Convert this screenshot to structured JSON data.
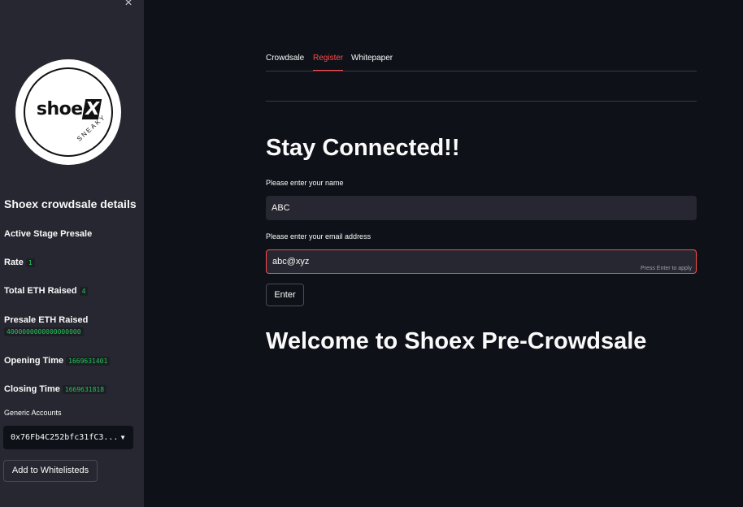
{
  "sidebar": {
    "close_glyph": "×",
    "logo": {
      "word": "shoe",
      "x_mark": "X",
      "tagline": "SNEAKY"
    },
    "title": "Shoex crowdsale details",
    "active_stage": "Active Stage Presale",
    "rate": {
      "label": "Rate",
      "value": "1"
    },
    "total_eth": {
      "label": "Total ETH Raised",
      "value": "4"
    },
    "presale_eth": {
      "label": "Presale ETH Raised",
      "value": "4000000000000000000"
    },
    "opening_time": {
      "label": "Opening Time",
      "value": "1669631401"
    },
    "closing_time": {
      "label": "Closing Time",
      "value": "1669631818"
    },
    "accounts_label": "Generic Accounts",
    "account_selected": "0x76Fb4C252bfc31fC3...",
    "whitelist_button": "Add to Whitelisteds"
  },
  "tabs": [
    {
      "label": "Crowdsale",
      "active": false
    },
    {
      "label": "Register",
      "active": true
    },
    {
      "label": "Whitepaper",
      "active": false
    }
  ],
  "main": {
    "heading": "Stay Connected!!",
    "name_label": "Please enter your name",
    "name_value": "ABC",
    "email_label": "Please enter your email address",
    "email_value": "abc@xyz",
    "email_hint": "Press Enter to apply",
    "enter_button": "Enter",
    "welcome": "Welcome to Shoex Pre-Crowdsale"
  },
  "colors": {
    "background": "#0e1117",
    "sidebar": "#262730",
    "accent": "#ff4b4b",
    "code_text": "#21c354"
  },
  "icons": {
    "close": "close-icon",
    "dropdown": "chevron-down-icon"
  }
}
